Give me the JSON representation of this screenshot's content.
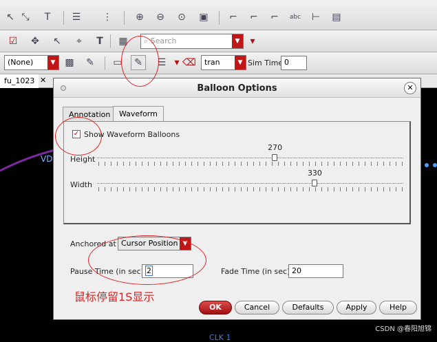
{
  "toolbar2": {
    "search_placeholder": "Search"
  },
  "toolbar3": {
    "net_combo": "(None)",
    "analysis_combo": "tran",
    "sim_time_label": "Sim Time",
    "sim_time_value": "0"
  },
  "design_tab": "fu_1023",
  "canvas": {
    "left_label": "VD",
    "bottom_label": "CLK 1"
  },
  "dialog": {
    "title": "Balloon Options",
    "tabs": [
      "Annotation",
      "Waveform"
    ],
    "active_tab": "Waveform",
    "show_waveform_balloons_label": "Show Waveform Balloons",
    "show_waveform_balloons_checked": true,
    "height_label": "Height",
    "height_value": "270",
    "height_fraction": 0.58,
    "width_label": "Width",
    "width_value": "330",
    "width_fraction": 0.71,
    "anchored_at_label": "Anchored at",
    "anchored_at_value": "Cursor Position",
    "pause_time_label": "Pause Time (in sec)",
    "pause_time_value": "2",
    "fade_time_label": "Fade Time (in sec)",
    "fade_time_value": "20",
    "buttons": {
      "ok": "OK",
      "cancel": "Cancel",
      "defaults": "Defaults",
      "apply": "Apply",
      "help": "Help"
    }
  },
  "annotation_note": "鼠标停留1S显示",
  "watermark": "CSDN @春阳旭锦",
  "colors": {
    "annotation": "#e02020",
    "ok_button": "#b01818",
    "dropdown_accent": "#c01818"
  }
}
